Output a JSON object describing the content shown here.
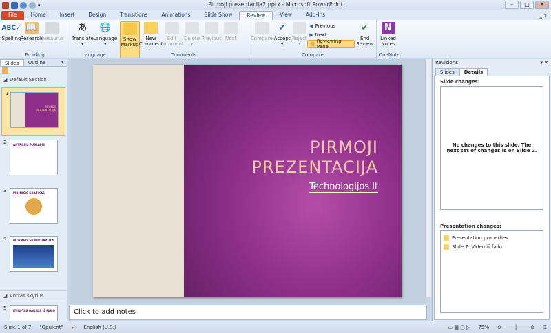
{
  "window": {
    "title": "Pirmoji prezentacija2.pptx - Microsoft PowerPoint"
  },
  "tabs": [
    "File",
    "Home",
    "Insert",
    "Design",
    "Transitions",
    "Animations",
    "Slide Show",
    "Review",
    "View",
    "Add-Ins"
  ],
  "ribbon": {
    "proofing": {
      "label": "Proofing",
      "spelling": "Spelling",
      "research": "Research",
      "thesaurus": "Thesaurus"
    },
    "language": {
      "label": "Language",
      "translate": "Translate",
      "language": "Language"
    },
    "comments": {
      "label": "Comments",
      "show_markup": "Show Markup",
      "new_comment": "New Comment",
      "edit_comment": "Edit Comment",
      "delete": "Delete",
      "previous": "Previous",
      "next": "Next"
    },
    "compare": {
      "label": "Compare",
      "compare": "Compare",
      "accept": "Accept",
      "reject": "Reject",
      "previous": "Previous",
      "next": "Next",
      "reviewing_pane": "Reviewing Pane",
      "end_review": "End Review"
    },
    "onenote": {
      "label": "OneNote",
      "linked_notes": "Linked Notes"
    }
  },
  "left_panel": {
    "tabs": [
      "Slides",
      "Outline"
    ],
    "sections": [
      "Default Section",
      "Antras skyrius"
    ],
    "slides": [
      {
        "num": "1",
        "title": "PIRMOJI PREZENTACIJA"
      },
      {
        "num": "2",
        "title": "ANTRASIS PUSLAPIS"
      },
      {
        "num": "3",
        "title": "PIRMASIS GRAFIKAS"
      },
      {
        "num": "4",
        "title": "PUSLAPIS SU NUOTRAUKA"
      },
      {
        "num": "5",
        "title": "ĮTERPTAS GARSAS IŠ FAILO"
      }
    ]
  },
  "slide": {
    "title_line1": "PIRMOJI",
    "title_line2": "PREZENTACIJA",
    "subtitle": "Technologijos.lt"
  },
  "notes": {
    "placeholder": "Click to add notes"
  },
  "revisions": {
    "title": "Revisions",
    "tabs": [
      "Slides",
      "Details"
    ],
    "slide_changes_label": "Slide changes:",
    "slide_changes_text": "No changes to this slide.  The next set of changes is on Slide 2.",
    "presentation_changes_label": "Presentation changes:",
    "presentation_changes": [
      "Presentation properties",
      "Slide 7: Video iš failo"
    ]
  },
  "status": {
    "slide": "Slide 1 of 7",
    "theme": "\"Opulent\"",
    "language": "English (U.S.)",
    "zoom": "75%"
  }
}
